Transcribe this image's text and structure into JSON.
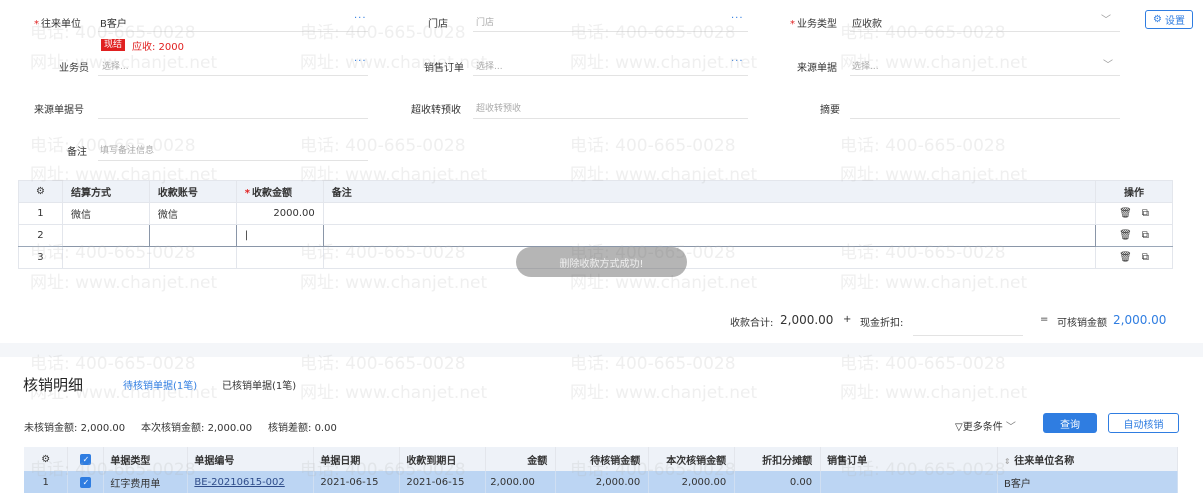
{
  "form": {
    "customer": {
      "label": "往来单位",
      "value": "B客户",
      "badge": "现结",
      "receivable": "应收: 2000"
    },
    "store": {
      "label": "门店",
      "placeholder": "门店"
    },
    "biz_type": {
      "label": "业务类型",
      "value": "应收款"
    },
    "settings_label": "设置",
    "salesman": {
      "label": "业务员",
      "placeholder": "选择..."
    },
    "sales_order": {
      "label": "销售订单",
      "placeholder": "选择..."
    },
    "source_doc": {
      "label": "来源单据",
      "placeholder": "选择..."
    },
    "source_doc_no": {
      "label": "来源单据号"
    },
    "over_receipt": {
      "label": "超收转预收",
      "placeholder": "超收转预收"
    },
    "summary": {
      "label": "摘要"
    },
    "remark": {
      "label": "备注",
      "placeholder": "填写备注信息"
    }
  },
  "receipt_table": {
    "headers": [
      "结算方式",
      "收款账号",
      "收款金额",
      "备注",
      "操作"
    ],
    "rows": [
      {
        "no": "1",
        "method": "微信",
        "account": "微信",
        "amount": "2000.00",
        "note": ""
      },
      {
        "no": "2",
        "method": "",
        "account": "",
        "amount": "|",
        "note": ""
      },
      {
        "no": "3",
        "method": "",
        "account": "",
        "amount": "",
        "note": ""
      }
    ],
    "toast": "删除收款方式成功!"
  },
  "totals": {
    "receipt_total_label": "收款合计:",
    "receipt_total": "2,000.00",
    "plus": "+",
    "discount_label": "现金折扣:",
    "equals": "=",
    "writeoff_label": "可核销金额",
    "writeoff_amount": "2,000.00"
  },
  "writeoff": {
    "title": "核销明细",
    "tab_pending": "待核销单据(1笔)",
    "tab_done": "已核销单据(1笔)",
    "unverified_label": "未核销金额:",
    "unverified": "2,000.00",
    "current_label": "本次核销金额:",
    "current": "2,000.00",
    "diff_label": "核销差额:",
    "diff": "0.00",
    "more_filter": "更多条件",
    "query_btn": "查询",
    "auto_btn": "自动核销",
    "headers": [
      "单据类型",
      "单据编号",
      "单据日期",
      "收款到期日",
      "金额",
      "待核销金额",
      "本次核销金额",
      "折扣分摊额",
      "销售订单",
      "往来单位名称"
    ],
    "rows": [
      {
        "no": "1",
        "type": "红字费用单",
        "code": "BE-20210615-002",
        "date": "2021-06-15",
        "due": "2021-06-15",
        "amount": "2,000.00",
        "pending": "2,000.00",
        "current": "2,000.00",
        "discount": "0.00",
        "order": "",
        "partner": "B客户"
      }
    ]
  },
  "watermark": {
    "phone": "电话: 400-665-0028",
    "site": "网址: www.chanjet.net"
  },
  "colors": {
    "accent": "#2f7de1",
    "required": "#e02020",
    "badge": "#e02020",
    "row_selected": "#bcd5f3"
  }
}
